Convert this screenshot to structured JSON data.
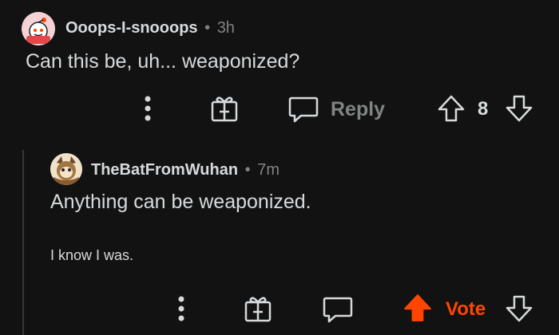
{
  "comment": {
    "username": "Ooops-I-snooops",
    "separator": "•",
    "time": "3h",
    "text": "Can this be, uh... weaponized?",
    "actions": {
      "more_icon": "more-vertical-icon",
      "award_icon": "gift-award-icon",
      "reply_label": "Reply",
      "vote_count": "8"
    }
  },
  "reply": {
    "username": "TheBatFromWuhan",
    "separator": "•",
    "time": "7m",
    "text": "Anything can be weaponized.",
    "subtext": "I know I was.",
    "actions": {
      "vote_label": "Vote",
      "upvote_color": "#ff4500"
    }
  },
  "colors": {
    "background": "#121212",
    "text": "#d7dadc",
    "muted": "#818384",
    "upvote_active": "#ff4500"
  }
}
